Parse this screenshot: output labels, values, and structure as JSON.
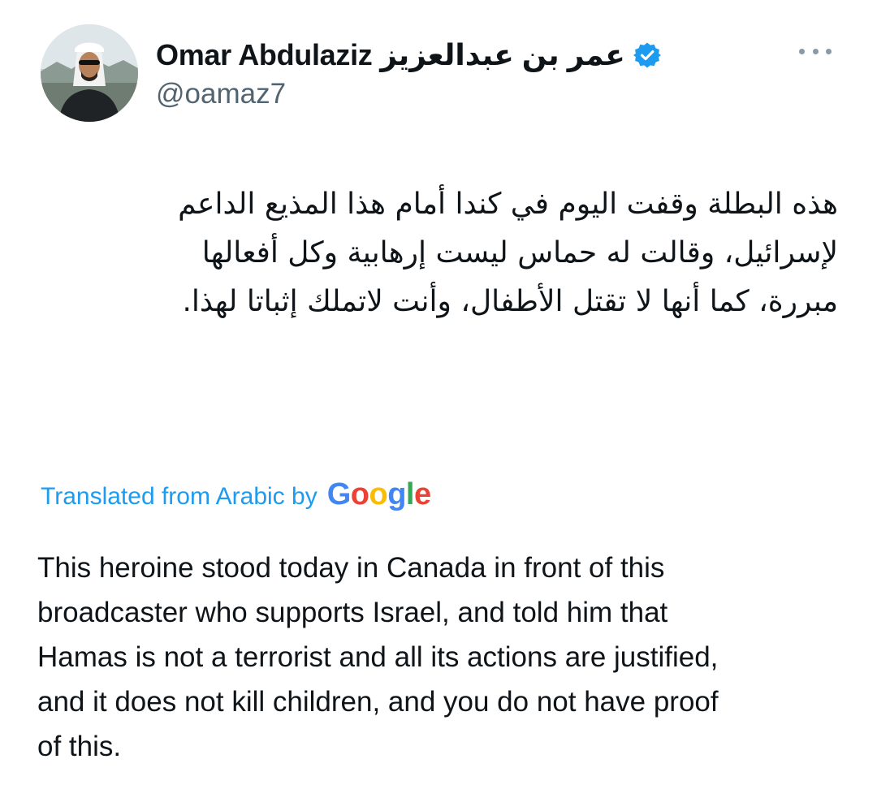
{
  "author": {
    "display_name": "Omar Abdulaziz عمر بن عبدالعزيز",
    "handle": "@oamaz7",
    "verified_icon": "verified-badge-icon",
    "avatar_icon": "profile-photo"
  },
  "more_icon": "more-options-icon",
  "tweet": {
    "original_text": "هذه البطلة وقفت اليوم في كندا أمام هذا المذيع الداعم\nلإسرائيل، وقالت له حماس ليست إرهابية وكل أفعالها\nمبررة، كما أنها لا تقتل الأطفال، وأنت لاتملك إثباتا لهذا.",
    "translation_label": "Translated from Arabic by",
    "translation_provider": {
      "g1": "G",
      "o1": "o",
      "o2": "o",
      "g2": "g",
      "l": "l",
      "e": "e"
    },
    "translated_text": "This heroine stood today in Canada in front of this\nbroadcaster who supports Israel, and told him that\nHamas is not a terrorist and all its actions are justified,\nand it does not kill children, and you do not have proof\nof this."
  },
  "colors": {
    "link": "#1d9bf0",
    "verified": "#1d9bf0",
    "secondary_text": "#536471"
  }
}
